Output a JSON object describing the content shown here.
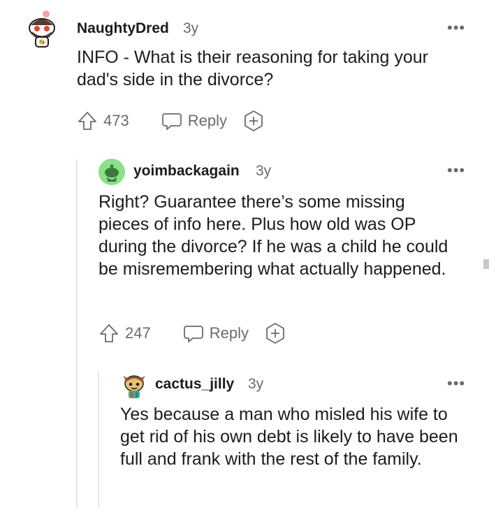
{
  "comments": [
    {
      "username": "NaughtyDred",
      "age": "3y",
      "body": "INFO - What is their reasoning for taking your dad's side in the divorce?",
      "upvotes": "473",
      "reply_label": "Reply"
    },
    {
      "username": "yoimbackagain",
      "age": "3y",
      "body": "Right? Guarantee there’s some missing pieces of info here. Plus how old was OP during the divorce? If he was a child he could be misremembering what actually happened.",
      "upvotes": "247",
      "reply_label": "Reply"
    },
    {
      "username": "cactus_jilly",
      "age": "3y",
      "body": "Yes because a man who misled his wife to get rid of his own debt is likely to have been full and frank with the rest of the family."
    }
  ],
  "more_glyph": "•••",
  "icons": {
    "upvote": "upvote-arrow-icon",
    "reply": "speech-bubble-icon",
    "award": "plus-award-icon"
  },
  "colors": {
    "text": "#1c1c1c",
    "muted": "#6b6b6b",
    "avatar2_bg": "#8be08b"
  }
}
